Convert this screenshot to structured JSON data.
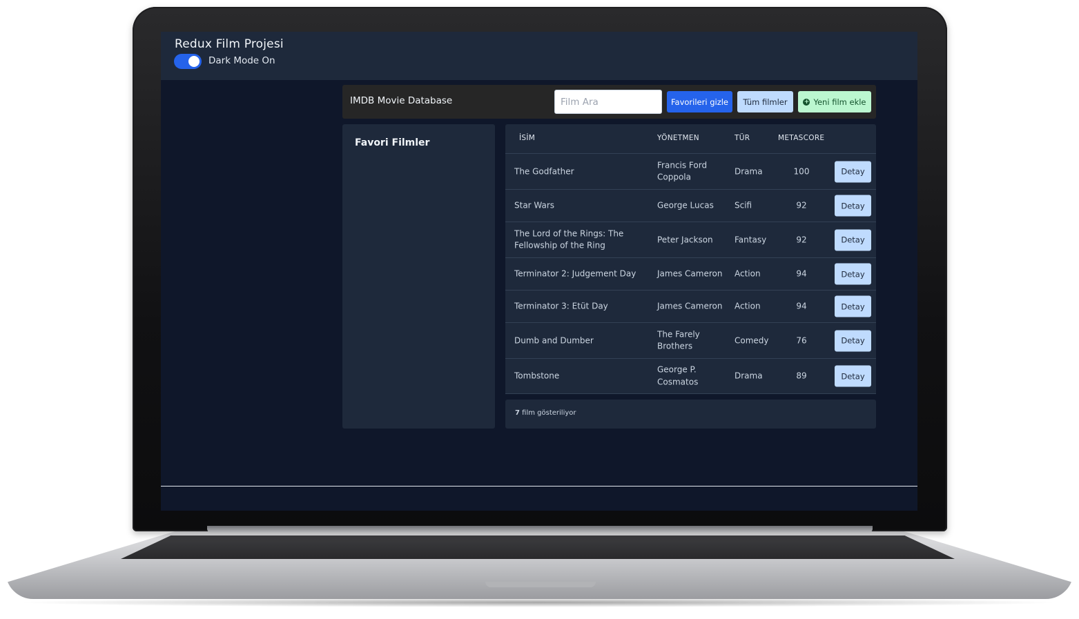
{
  "app": {
    "title": "Redux Film Projesi",
    "dark_mode_label": "Dark Mode On",
    "dark_mode_on": true
  },
  "toolbar": {
    "title": "IMDB Movie Database",
    "search_placeholder": "Film Ara",
    "search_value": "",
    "hide_favorites_label": "Favorileri gizle",
    "all_movies_label": "Tüm filmler",
    "add_movie_label": "Yeni film ekle",
    "add_icon": "plus-circle-icon"
  },
  "favorites": {
    "title": "Favori Filmler"
  },
  "table": {
    "headers": [
      "İSİM",
      "YÖNETMEN",
      "TÜR",
      "METASCORE"
    ],
    "detail_label": "Detay",
    "rows": [
      {
        "name": "The Godfather",
        "director": "Francis Ford Coppola",
        "genre": "Drama",
        "metascore": "100"
      },
      {
        "name": "Star Wars",
        "director": "George Lucas",
        "genre": "Scifi",
        "metascore": "92"
      },
      {
        "name": "The Lord of the Rings: The Fellowship of the Ring",
        "director": "Peter Jackson",
        "genre": "Fantasy",
        "metascore": "92"
      },
      {
        "name": "Terminator 2: Judgement Day",
        "director": "James Cameron",
        "genre": "Action",
        "metascore": "94"
      },
      {
        "name": "Terminator 3: Etüt Day",
        "director": "James Cameron",
        "genre": "Action",
        "metascore": "94"
      },
      {
        "name": "Dumb and Dumber",
        "director": "The Farely Brothers",
        "genre": "Comedy",
        "metascore": "76"
      },
      {
        "name": "Tombstone",
        "director": "George P. Cosmatos",
        "genre": "Drama",
        "metascore": "89"
      }
    ]
  },
  "footer": {
    "count": "7",
    "text": "film gösteriliyor"
  },
  "colors": {
    "header_bg": "#1e293b",
    "screen_bg": "#0f172a",
    "primary_blue": "#2563eb",
    "light_blue": "#bfdbfe",
    "light_green": "#bbf7d0"
  }
}
